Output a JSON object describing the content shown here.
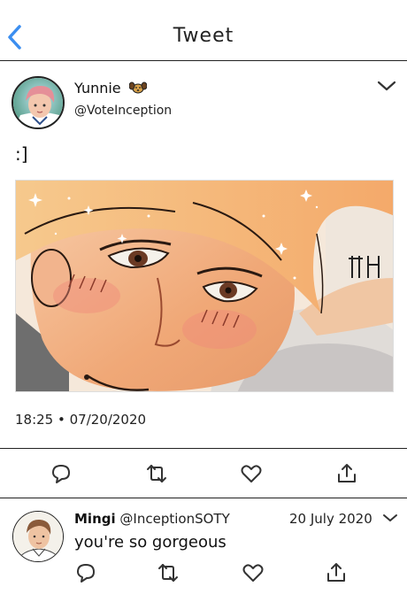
{
  "header": {
    "title": "Tweet"
  },
  "tweet": {
    "author_name": "Yunnie",
    "author_handle": "@VoteInception",
    "text": ":]",
    "timestamp": "18:25 • 07/20/2020"
  },
  "reply": {
    "author_name": "Mingi",
    "author_handle": "@InceptionSOTY",
    "date": "20 July 2020",
    "text": "you're so gorgeous"
  },
  "icons": {
    "back": "chevron-left-icon",
    "menu": "chevron-down-icon",
    "reply": "comment-icon",
    "retweet": "retweet-icon",
    "like": "heart-icon",
    "share": "share-icon",
    "badge": "dog-face-icon"
  },
  "colors": {
    "accent": "#3b8ef0"
  }
}
